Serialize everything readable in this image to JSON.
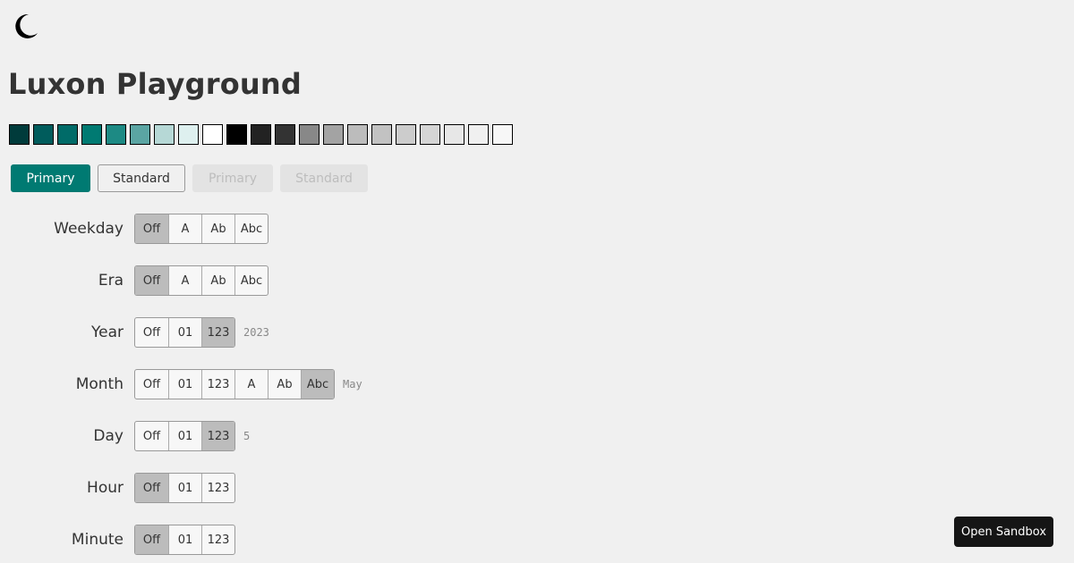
{
  "logo": {
    "icon": "moon-icon"
  },
  "page": {
    "title": "Luxon Playground"
  },
  "palette": {
    "swatches": [
      "#003b3b",
      "#005c5c",
      "#006b68",
      "#007a72",
      "#1d8a84",
      "#5ba5a3",
      "#b6d8d6",
      "#def0ef",
      "#ffffff",
      "#000000",
      "#222222",
      "#333333",
      "#888888",
      "#a3a3a3",
      "#bcbcbc",
      "#c2c2c2",
      "#cccccc",
      "#d5d5d5",
      "#e7e7e7",
      "#f0f0f0",
      "#f7f7f7"
    ]
  },
  "buttons": {
    "primary": "Primary",
    "standard": "Standard",
    "primary_disabled": "Primary",
    "standard_disabled": "Standard"
  },
  "fields": [
    {
      "label": "Weekday",
      "options": [
        "Off",
        "A",
        "Ab",
        "Abc"
      ],
      "selected": 0,
      "preview": ""
    },
    {
      "label": "Era",
      "options": [
        "Off",
        "A",
        "Ab",
        "Abc"
      ],
      "selected": 0,
      "preview": ""
    },
    {
      "label": "Year",
      "options": [
        "Off",
        "01",
        "123"
      ],
      "selected": 2,
      "preview": "2023"
    },
    {
      "label": "Month",
      "options": [
        "Off",
        "01",
        "123",
        "A",
        "Ab",
        "Abc"
      ],
      "selected": 5,
      "preview": "May"
    },
    {
      "label": "Day",
      "options": [
        "Off",
        "01",
        "123"
      ],
      "selected": 2,
      "preview": "5"
    },
    {
      "label": "Hour",
      "options": [
        "Off",
        "01",
        "123"
      ],
      "selected": 0,
      "preview": ""
    },
    {
      "label": "Minute",
      "options": [
        "Off",
        "01",
        "123"
      ],
      "selected": 0,
      "preview": ""
    }
  ],
  "sandbox": {
    "label": "Open Sandbox"
  }
}
